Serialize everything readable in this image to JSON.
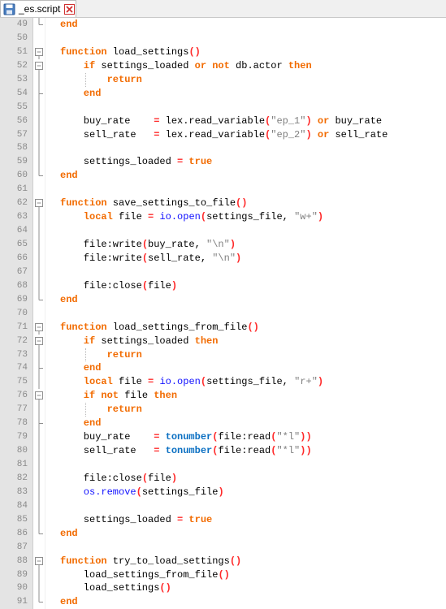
{
  "tab": {
    "label": "_es.script",
    "file_icon": "file-save-icon",
    "close_icon": "close-x-icon",
    "close_color": "#d03030"
  },
  "colors": {
    "keyword": "#f26b00",
    "builtin": "#0a6fc2",
    "library": "#1212ff",
    "string": "#808080",
    "operator": "#ff2a2a",
    "line_number": "#8a8a8a",
    "gutter_bg": "#e4e4e4"
  },
  "lines": [
    {
      "n": "49",
      "fold": "end",
      "indent": 0,
      "guides": [],
      "tokens": [
        [
          "kw",
          "end"
        ]
      ]
    },
    {
      "n": "50",
      "fold": "",
      "indent": 0,
      "guides": [],
      "tokens": []
    },
    {
      "n": "51",
      "fold": "open",
      "indent": 0,
      "guides": [],
      "tokens": [
        [
          "kw",
          "function"
        ],
        [
          "plain",
          " load_settings"
        ],
        [
          "op",
          "()"
        ]
      ]
    },
    {
      "n": "52",
      "fold": "open",
      "indent": 4,
      "guides": [],
      "tokens": [
        [
          "kw",
          "if"
        ],
        [
          "plain",
          " settings_loaded "
        ],
        [
          "kw",
          "or not"
        ],
        [
          "plain",
          " db.actor "
        ],
        [
          "kw",
          "then"
        ]
      ]
    },
    {
      "n": "53",
      "fold": "line",
      "indent": 8,
      "guides": [
        4
      ],
      "tokens": [
        [
          "kw",
          "return"
        ]
      ]
    },
    {
      "n": "54",
      "fold": "tee",
      "indent": 4,
      "guides": [],
      "tokens": [
        [
          "kw",
          "end"
        ]
      ]
    },
    {
      "n": "55",
      "fold": "line",
      "indent": 0,
      "guides": [],
      "tokens": []
    },
    {
      "n": "56",
      "fold": "line",
      "indent": 4,
      "guides": [],
      "tokens": [
        [
          "plain",
          "buy_rate    "
        ],
        [
          "op",
          "="
        ],
        [
          "plain",
          " lex.read_variable"
        ],
        [
          "op",
          "("
        ],
        [
          "str",
          "\"ep_1\""
        ],
        [
          "op",
          ")"
        ],
        [
          "plain",
          " "
        ],
        [
          "kw",
          "or"
        ],
        [
          "plain",
          " buy_rate"
        ]
      ]
    },
    {
      "n": "57",
      "fold": "line",
      "indent": 4,
      "guides": [],
      "tokens": [
        [
          "plain",
          "sell_rate   "
        ],
        [
          "op",
          "="
        ],
        [
          "plain",
          " lex.read_variable"
        ],
        [
          "op",
          "("
        ],
        [
          "str",
          "\"ep_2\""
        ],
        [
          "op",
          ")"
        ],
        [
          "plain",
          " "
        ],
        [
          "kw",
          "or"
        ],
        [
          "plain",
          " sell_rate"
        ]
      ]
    },
    {
      "n": "58",
      "fold": "line",
      "indent": 0,
      "guides": [],
      "tokens": []
    },
    {
      "n": "59",
      "fold": "line",
      "indent": 4,
      "guides": [],
      "tokens": [
        [
          "plain",
          "settings_loaded "
        ],
        [
          "op",
          "="
        ],
        [
          "plain",
          " "
        ],
        [
          "kw",
          "true"
        ]
      ]
    },
    {
      "n": "60",
      "fold": "end",
      "indent": 0,
      "guides": [],
      "tokens": [
        [
          "kw",
          "end"
        ]
      ]
    },
    {
      "n": "61",
      "fold": "",
      "indent": 0,
      "guides": [],
      "tokens": []
    },
    {
      "n": "62",
      "fold": "open",
      "indent": 0,
      "guides": [],
      "tokens": [
        [
          "kw",
          "function"
        ],
        [
          "plain",
          " save_settings_to_file"
        ],
        [
          "op",
          "()"
        ]
      ]
    },
    {
      "n": "63",
      "fold": "line",
      "indent": 4,
      "guides": [],
      "tokens": [
        [
          "kw",
          "local"
        ],
        [
          "plain",
          " file "
        ],
        [
          "op",
          "="
        ],
        [
          "plain",
          " "
        ],
        [
          "lib",
          "io.open"
        ],
        [
          "op",
          "("
        ],
        [
          "plain",
          "settings_file, "
        ],
        [
          "str",
          "\"w+\""
        ],
        [
          "op",
          ")"
        ]
      ]
    },
    {
      "n": "64",
      "fold": "line",
      "indent": 0,
      "guides": [],
      "tokens": []
    },
    {
      "n": "65",
      "fold": "line",
      "indent": 4,
      "guides": [],
      "tokens": [
        [
          "plain",
          "file:write"
        ],
        [
          "op",
          "("
        ],
        [
          "plain",
          "buy_rate, "
        ],
        [
          "str",
          "\"\\n\""
        ],
        [
          "op",
          ")"
        ]
      ]
    },
    {
      "n": "66",
      "fold": "line",
      "indent": 4,
      "guides": [],
      "tokens": [
        [
          "plain",
          "file:write"
        ],
        [
          "op",
          "("
        ],
        [
          "plain",
          "sell_rate, "
        ],
        [
          "str",
          "\"\\n\""
        ],
        [
          "op",
          ")"
        ]
      ]
    },
    {
      "n": "67",
      "fold": "line",
      "indent": 0,
      "guides": [],
      "tokens": []
    },
    {
      "n": "68",
      "fold": "line",
      "indent": 4,
      "guides": [],
      "tokens": [
        [
          "plain",
          "file:close"
        ],
        [
          "op",
          "("
        ],
        [
          "plain",
          "file"
        ],
        [
          "op",
          ")"
        ]
      ]
    },
    {
      "n": "69",
      "fold": "end",
      "indent": 0,
      "guides": [],
      "tokens": [
        [
          "kw",
          "end"
        ]
      ]
    },
    {
      "n": "70",
      "fold": "",
      "indent": 0,
      "guides": [],
      "tokens": []
    },
    {
      "n": "71",
      "fold": "open",
      "indent": 0,
      "guides": [],
      "tokens": [
        [
          "kw",
          "function"
        ],
        [
          "plain",
          " load_settings_from_file"
        ],
        [
          "op",
          "()"
        ]
      ]
    },
    {
      "n": "72",
      "fold": "open",
      "indent": 4,
      "guides": [],
      "tokens": [
        [
          "kw",
          "if"
        ],
        [
          "plain",
          " settings_loaded "
        ],
        [
          "kw",
          "then"
        ]
      ]
    },
    {
      "n": "73",
      "fold": "line",
      "indent": 8,
      "guides": [
        4
      ],
      "tokens": [
        [
          "kw",
          "return"
        ]
      ]
    },
    {
      "n": "74",
      "fold": "tee",
      "indent": 4,
      "guides": [],
      "tokens": [
        [
          "kw",
          "end"
        ]
      ]
    },
    {
      "n": "75",
      "fold": "line",
      "indent": 4,
      "guides": [],
      "tokens": [
        [
          "kw",
          "local"
        ],
        [
          "plain",
          " file "
        ],
        [
          "op",
          "="
        ],
        [
          "plain",
          " "
        ],
        [
          "lib",
          "io.open"
        ],
        [
          "op",
          "("
        ],
        [
          "plain",
          "settings_file, "
        ],
        [
          "str",
          "\"r+\""
        ],
        [
          "op",
          ")"
        ]
      ]
    },
    {
      "n": "76",
      "fold": "open",
      "indent": 4,
      "guides": [],
      "tokens": [
        [
          "kw",
          "if not"
        ],
        [
          "plain",
          " file "
        ],
        [
          "kw",
          "then"
        ]
      ]
    },
    {
      "n": "77",
      "fold": "line",
      "indent": 8,
      "guides": [
        4
      ],
      "tokens": [
        [
          "kw",
          "return"
        ]
      ]
    },
    {
      "n": "78",
      "fold": "tee",
      "indent": 4,
      "guides": [],
      "tokens": [
        [
          "kw",
          "end"
        ]
      ]
    },
    {
      "n": "79",
      "fold": "line",
      "indent": 4,
      "guides": [],
      "tokens": [
        [
          "plain",
          "buy_rate    "
        ],
        [
          "op",
          "="
        ],
        [
          "plain",
          " "
        ],
        [
          "fn",
          "tonumber"
        ],
        [
          "op",
          "("
        ],
        [
          "plain",
          "file:read"
        ],
        [
          "op",
          "("
        ],
        [
          "str",
          "\"*l\""
        ],
        [
          "op",
          "))"
        ]
      ]
    },
    {
      "n": "80",
      "fold": "line",
      "indent": 4,
      "guides": [],
      "tokens": [
        [
          "plain",
          "sell_rate   "
        ],
        [
          "op",
          "="
        ],
        [
          "plain",
          " "
        ],
        [
          "fn",
          "tonumber"
        ],
        [
          "op",
          "("
        ],
        [
          "plain",
          "file:read"
        ],
        [
          "op",
          "("
        ],
        [
          "str",
          "\"*l\""
        ],
        [
          "op",
          "))"
        ]
      ]
    },
    {
      "n": "81",
      "fold": "line",
      "indent": 0,
      "guides": [],
      "tokens": []
    },
    {
      "n": "82",
      "fold": "line",
      "indent": 4,
      "guides": [],
      "tokens": [
        [
          "plain",
          "file:close"
        ],
        [
          "op",
          "("
        ],
        [
          "plain",
          "file"
        ],
        [
          "op",
          ")"
        ]
      ]
    },
    {
      "n": "83",
      "fold": "line",
      "indent": 4,
      "guides": [],
      "tokens": [
        [
          "lib",
          "os.remove"
        ],
        [
          "op",
          "("
        ],
        [
          "plain",
          "settings_file"
        ],
        [
          "op",
          ")"
        ]
      ]
    },
    {
      "n": "84",
      "fold": "line",
      "indent": 0,
      "guides": [],
      "tokens": []
    },
    {
      "n": "85",
      "fold": "line",
      "indent": 4,
      "guides": [],
      "tokens": [
        [
          "plain",
          "settings_loaded "
        ],
        [
          "op",
          "="
        ],
        [
          "plain",
          " "
        ],
        [
          "kw",
          "true"
        ]
      ]
    },
    {
      "n": "86",
      "fold": "end",
      "indent": 0,
      "guides": [],
      "tokens": [
        [
          "kw",
          "end"
        ]
      ]
    },
    {
      "n": "87",
      "fold": "",
      "indent": 0,
      "guides": [],
      "tokens": []
    },
    {
      "n": "88",
      "fold": "open",
      "indent": 0,
      "guides": [],
      "tokens": [
        [
          "kw",
          "function"
        ],
        [
          "plain",
          " try_to_load_settings"
        ],
        [
          "op",
          "()"
        ]
      ]
    },
    {
      "n": "89",
      "fold": "line",
      "indent": 4,
      "guides": [],
      "tokens": [
        [
          "plain",
          "load_settings_from_file"
        ],
        [
          "op",
          "()"
        ]
      ]
    },
    {
      "n": "90",
      "fold": "line",
      "indent": 4,
      "guides": [],
      "tokens": [
        [
          "plain",
          "load_settings"
        ],
        [
          "op",
          "()"
        ]
      ]
    },
    {
      "n": "91",
      "fold": "end",
      "indent": 0,
      "guides": [],
      "tokens": [
        [
          "kw",
          "end"
        ]
      ]
    }
  ]
}
